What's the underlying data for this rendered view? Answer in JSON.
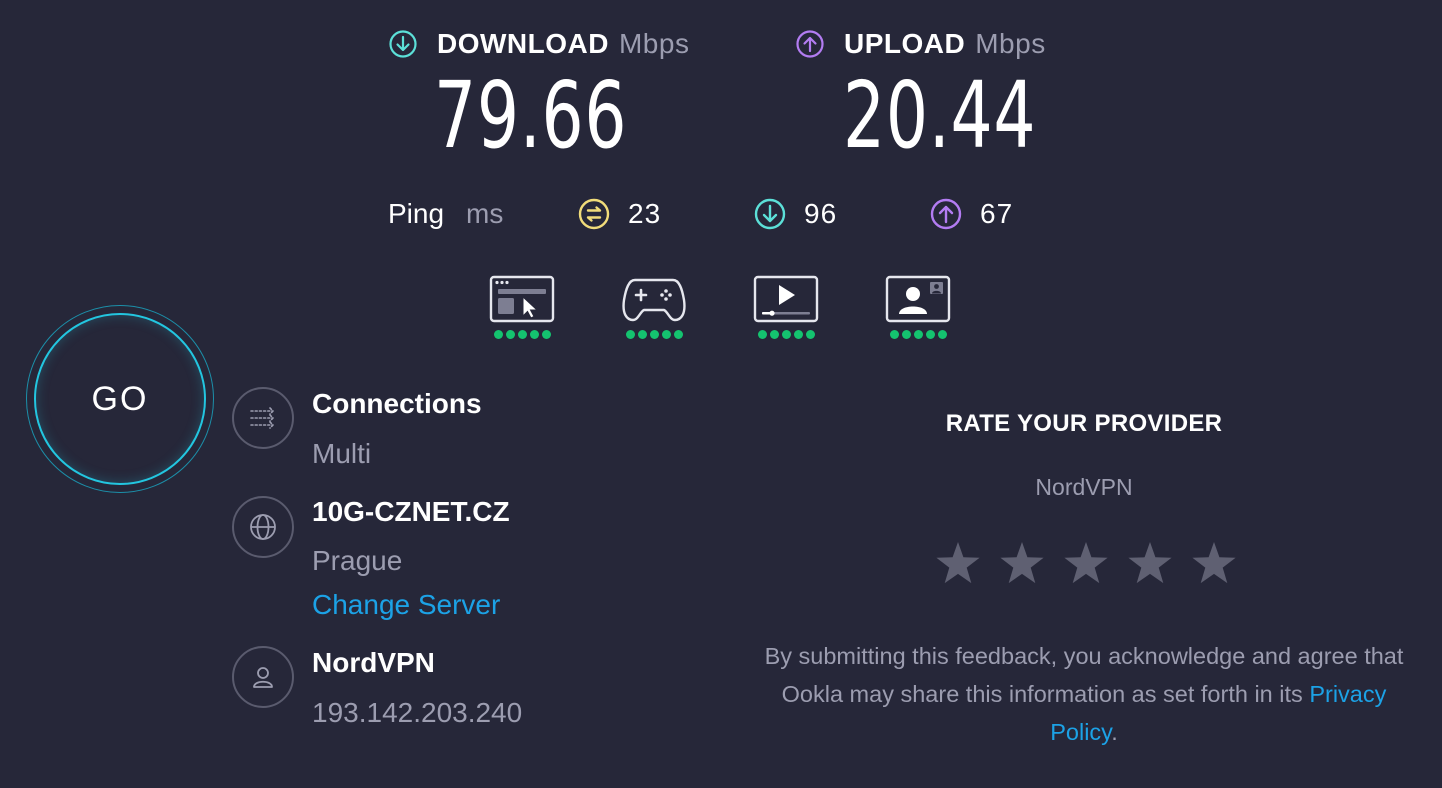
{
  "download": {
    "label": "DOWNLOAD",
    "unit": "Mbps",
    "value": "79.66",
    "icon": "download-arrow-icon",
    "color": "#5ce0d8"
  },
  "upload": {
    "label": "UPLOAD",
    "unit": "Mbps",
    "value": "20.44",
    "icon": "upload-arrow-icon",
    "color": "#b37cf2"
  },
  "ping": {
    "label": "Ping",
    "unit": "ms",
    "idle": "23",
    "download": "96",
    "upload": "67",
    "idle_color": "#f1dc7a",
    "download_color": "#5ce0d8",
    "upload_color": "#b37cf2"
  },
  "usecases": [
    {
      "icon": "web-browsing-icon",
      "rating": 5
    },
    {
      "icon": "gaming-controller-icon",
      "rating": 5
    },
    {
      "icon": "video-streaming-icon",
      "rating": 5
    },
    {
      "icon": "video-chat-icon",
      "rating": 5
    }
  ],
  "go_button": {
    "label": "GO",
    "ring_color": "#23c6e0"
  },
  "connections": {
    "title": "Connections",
    "value": "Multi",
    "icon": "connections-arrows-icon"
  },
  "server": {
    "title": "10G-CZNET.CZ",
    "location": "Prague",
    "change_link": "Change Server",
    "icon": "globe-icon"
  },
  "provider": {
    "title": "NordVPN",
    "ip": "193.142.203.240",
    "icon": "user-icon"
  },
  "rate": {
    "title": "RATE YOUR PROVIDER",
    "provider_name": "NordVPN",
    "stars_total": 5,
    "star_color": "#5f6072",
    "disclaimer_before": "By submitting this feedback, you acknowledge and agree that Ookla may share this information as set forth in its ",
    "privacy_link": "Privacy Policy",
    "disclaimer_after": "."
  },
  "colors": {
    "background": "#262739",
    "link": "#1ca2e6",
    "rating_dot": "#14c36f",
    "muted_text": "#9c9db0"
  }
}
